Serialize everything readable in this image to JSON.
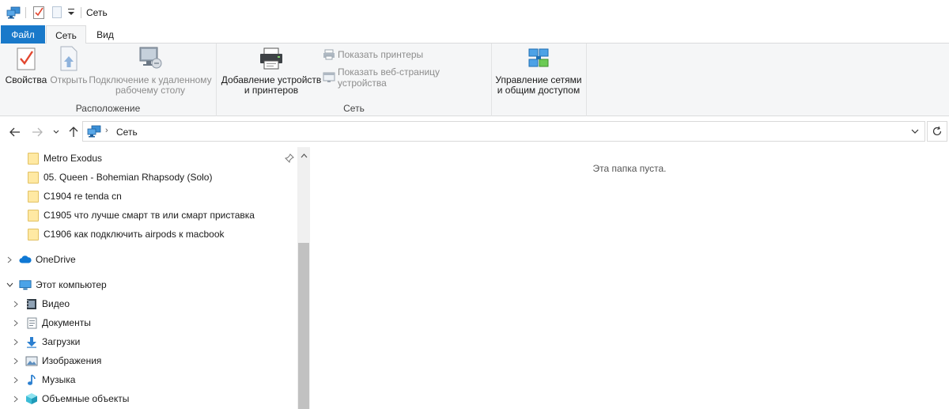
{
  "titlebar": {
    "title": "Сеть"
  },
  "tabs": {
    "file": "Файл",
    "network": "Сеть",
    "view": "Вид"
  },
  "ribbon": {
    "groups": {
      "location": "Расположение",
      "network": "Сеть"
    },
    "buttons": {
      "properties": "Свойства",
      "open": "Открыть",
      "remote_line1": "Подключение к удаленному",
      "remote_line2": "рабочему столу",
      "add_devices_line1": "Добавление устройств",
      "add_devices_line2": "и принтеров",
      "show_printers": "Показать принтеры",
      "show_device_page": "Показать веб-страницу устройства",
      "network_center_line1": "Управление сетями",
      "network_center_line2": "и общим доступом"
    }
  },
  "address": {
    "path": "Сеть"
  },
  "navpane": {
    "quick_items": [
      "Metro Exodus",
      "05. Queen - Bohemian Rhapsody (Solo)",
      "C1904 re tenda cn",
      "C1905 что лучше смарт тв или смарт приставка",
      "C1906 как подключить airpods к macbook"
    ],
    "onedrive": "OneDrive",
    "this_pc": "Этот компьютер",
    "pc_items": [
      "Видео",
      "Документы",
      "Загрузки",
      "Изображения",
      "Музыка",
      "Объемные объекты"
    ]
  },
  "content": {
    "empty_message": "Эта папка пуста."
  },
  "colors": {
    "file_tab": "#1979ca",
    "ribbon_bg": "#f5f6f7"
  }
}
